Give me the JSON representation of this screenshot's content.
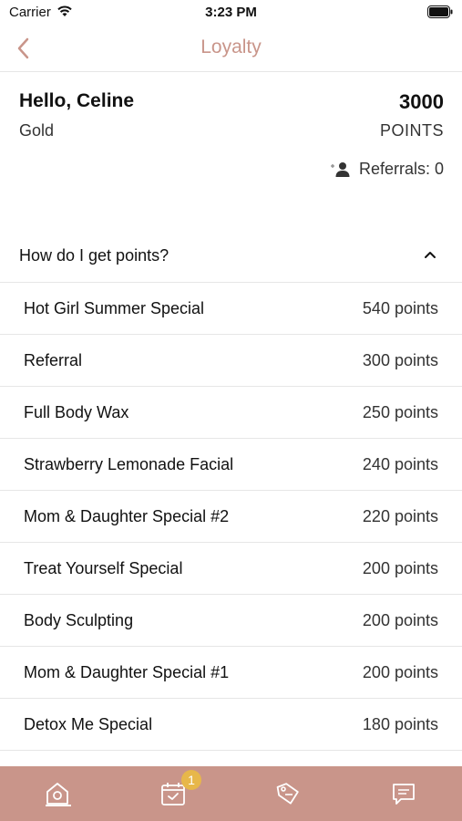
{
  "status_bar": {
    "carrier": "Carrier",
    "time": "3:23 PM"
  },
  "nav": {
    "title": "Loyalty"
  },
  "summary": {
    "greeting": "Hello, Celine",
    "tier": "Gold",
    "points": "3000",
    "points_label": "POINTS",
    "referrals": "Referrals: 0"
  },
  "faq": {
    "title": "How do I get points?"
  },
  "rules": [
    {
      "name": "Hot Girl Summer Special",
      "points": "540 points"
    },
    {
      "name": "Referral",
      "points": "300 points"
    },
    {
      "name": "Full Body Wax",
      "points": "250 points"
    },
    {
      "name": "Strawberry Lemonade Facial",
      "points": "240 points"
    },
    {
      "name": "Mom & Daughter Special #2",
      "points": "220 points"
    },
    {
      "name": "Treat Yourself Special",
      "points": "200 points"
    },
    {
      "name": "Body Sculpting",
      "points": "200 points"
    },
    {
      "name": "Mom & Daughter Special #1",
      "points": "200 points"
    },
    {
      "name": "Detox Me Special",
      "points": "180 points"
    }
  ],
  "tab_bar": {
    "background": "#c9958a",
    "appointments_badge": "1",
    "tabs": [
      "home-icon",
      "calendar-icon",
      "tag-icon",
      "chat-icon"
    ]
  },
  "colors": {
    "accent": "#c9958a",
    "badge": "#e7b74a"
  }
}
